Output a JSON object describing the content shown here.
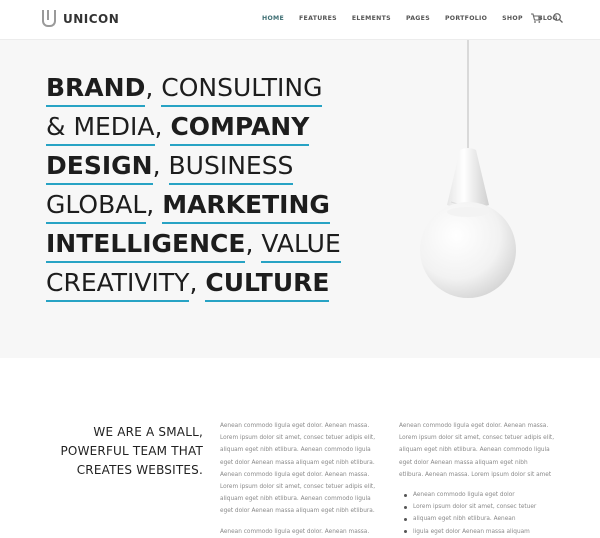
{
  "brand": {
    "name": "UNICON"
  },
  "nav": {
    "items": [
      {
        "label": "HOME",
        "active": true
      },
      {
        "label": "FEATURES"
      },
      {
        "label": "ELEMENTS"
      },
      {
        "label": "PAGES"
      },
      {
        "label": "PORTFOLIO"
      },
      {
        "label": "SHOP"
      },
      {
        "label": "BLOG"
      }
    ],
    "icons": [
      "cart-icon",
      "search-icon"
    ]
  },
  "hero": {
    "accent_color": "#28a3c4",
    "lines": [
      [
        {
          "text": "BRAND",
          "bold": true
        },
        {
          "text": ", ",
          "sep": true
        },
        {
          "text": "CONSULTING",
          "bold": false
        }
      ],
      [
        {
          "text": "& MEDIA",
          "bold": false
        },
        {
          "text": ", ",
          "sep": true
        },
        {
          "text": "COMPANY",
          "bold": true
        }
      ],
      [
        {
          "text": "DESIGN",
          "bold": true
        },
        {
          "text": ", ",
          "sep": true
        },
        {
          "text": "BUSINESS",
          "bold": false
        }
      ],
      [
        {
          "text": "GLOBAL",
          "bold": false
        },
        {
          "text": ", ",
          "sep": true
        },
        {
          "text": "MARKETING",
          "bold": true
        }
      ],
      [
        {
          "text": "INTELLIGENCE",
          "bold": true
        },
        {
          "text": ", ",
          "sep": true
        },
        {
          "text": "VALUE",
          "bold": false
        }
      ],
      [
        {
          "text": "CREATIVITY",
          "bold": false
        },
        {
          "text": ", ",
          "sep": true
        },
        {
          "text": "CULTURE",
          "bold": true
        }
      ]
    ]
  },
  "tagline": [
    "WE ARE A SMALL,",
    "POWERFUL TEAM THAT",
    "CREATES WEBSITES."
  ],
  "column1": {
    "paragraph1": [
      "Aenean commodo ligula eget dolor. Aenean massa.",
      "Lorem ipsum dolor sit amet, consec tetuer adipis elit,",
      "aliquam eget nibh etlibura. Aenean commodo ligula",
      "eget dolor Aenean massa aliquam eget nibh etlibura.",
      "Aenean commodo ligula eget dolor. Aenean massa.",
      "Lorem ipsum dolor sit amet, consec tetuer adipis elit,",
      "aliquam eget nibh etlibura. Aenean commodo ligula",
      "eget dolor Aenean massa aliquam eget nibh etlibura."
    ],
    "paragraph2": [
      "Aenean commodo ligula eget dolor. Aenean massa."
    ]
  },
  "column2": {
    "paragraph1": [
      "Aenean commodo ligula eget dolor. Aenean massa.",
      "Lorem ipsum dolor sit amet, consec tetuer adipis elit,",
      "aliquam eget nibh etlibura. Aenean commodo ligula",
      "eget dolor Aenean massa aliquam eget nibh",
      "etlibura. Aenean massa. Lorem ipsum dolor sit amet"
    ],
    "bullets": [
      "Aenean commodo ligula eget dolor",
      "Lorem ipsum dolor sit amet, consec tetuer",
      "aliquam eget nibh etlibura. Aenean",
      "ligula eget dolor Aenean massa aliquam"
    ]
  }
}
